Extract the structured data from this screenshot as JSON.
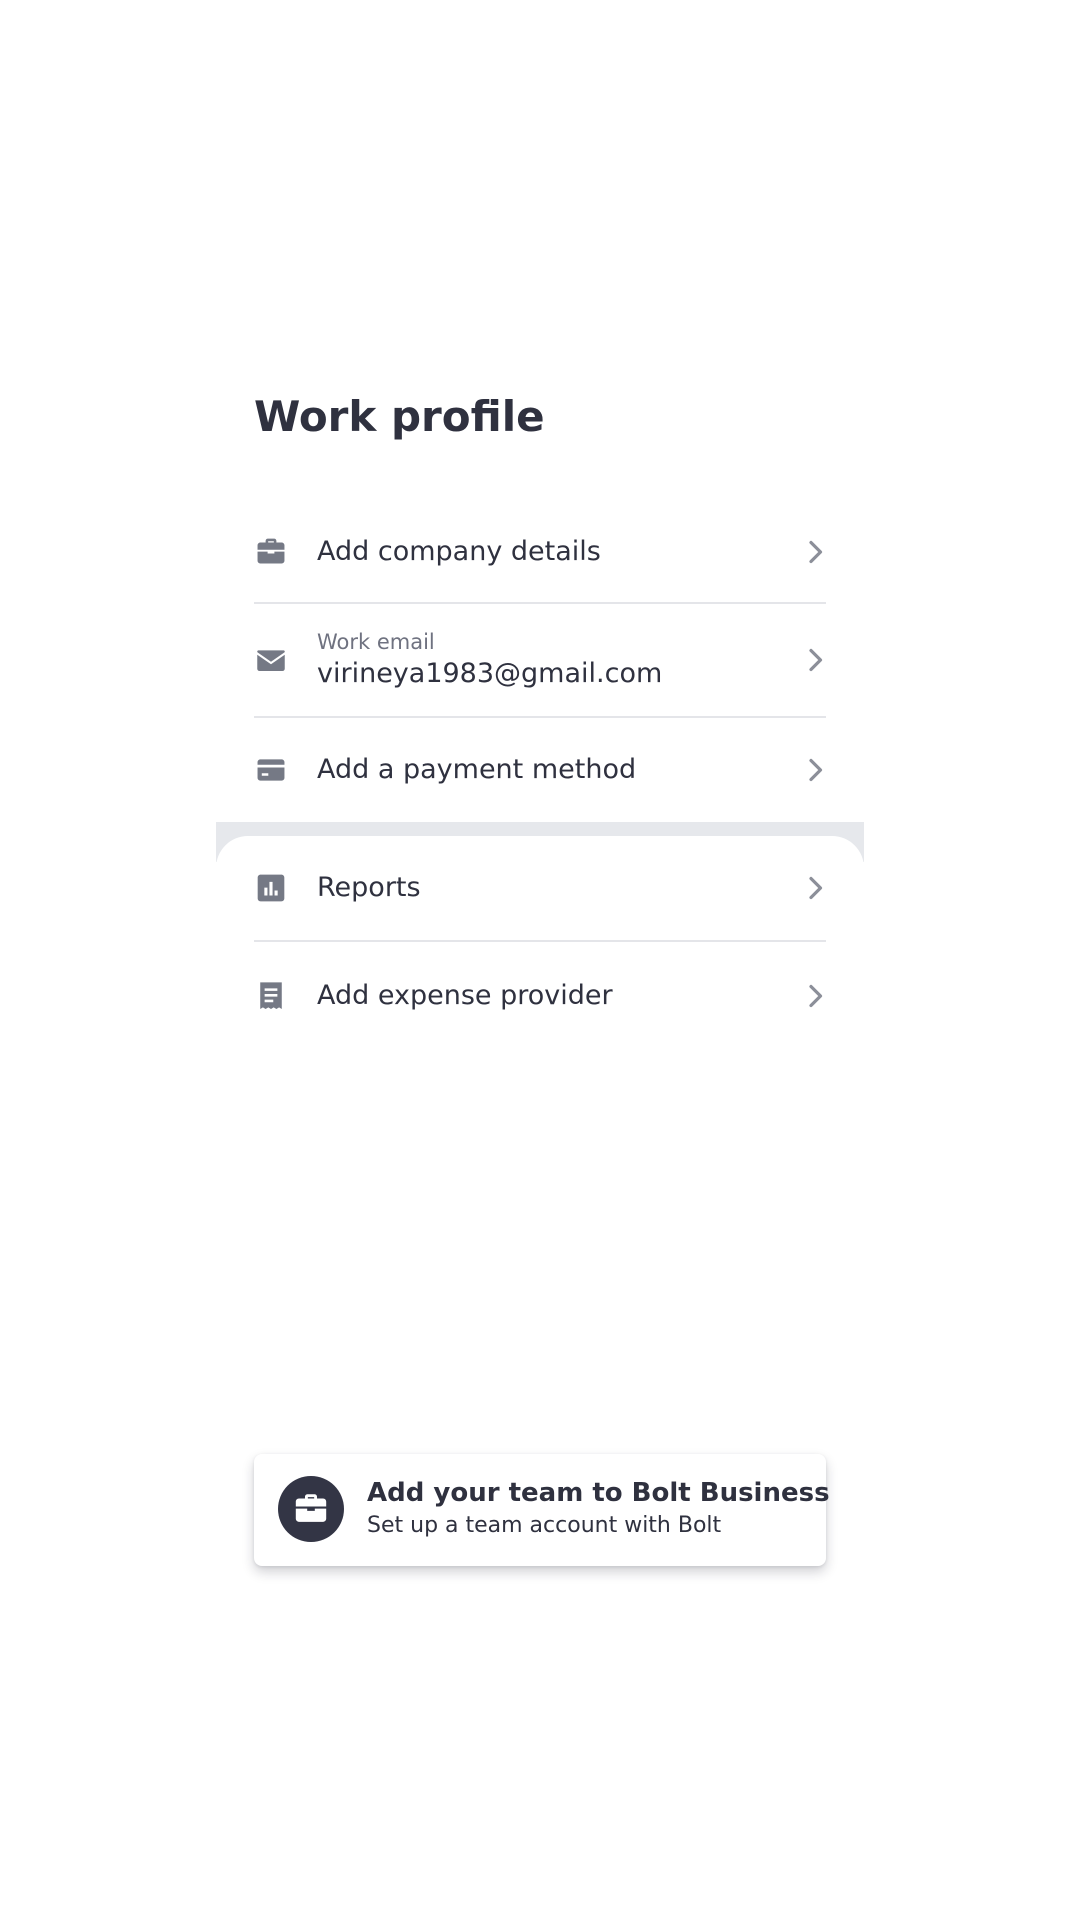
{
  "page": {
    "title": "Work profile"
  },
  "work_profile": {
    "items": [
      {
        "label": "Add company details",
        "icon": "briefcase-icon"
      },
      {
        "label": "Work email",
        "value": "virineya1983@gmail.com",
        "icon": "mail-icon"
      },
      {
        "label": "Add a payment method",
        "icon": "credit-card-icon"
      }
    ]
  },
  "tools": {
    "items": [
      {
        "label": "Reports",
        "icon": "bar-chart-icon"
      },
      {
        "label": "Add expense provider",
        "icon": "receipt-icon"
      }
    ]
  },
  "promo": {
    "title": "Add your team to Bolt Business",
    "subtitle": "Set up a team account with Bolt",
    "icon": "briefcase-icon"
  },
  "theme": {
    "text": "#2f313f",
    "secondary_text": "#6f7280",
    "icon": "#757985",
    "divider": "#e4e5e9",
    "separator": "#e6e8ec",
    "promo_icon_background": "#333545",
    "background": "#ffffff"
  }
}
